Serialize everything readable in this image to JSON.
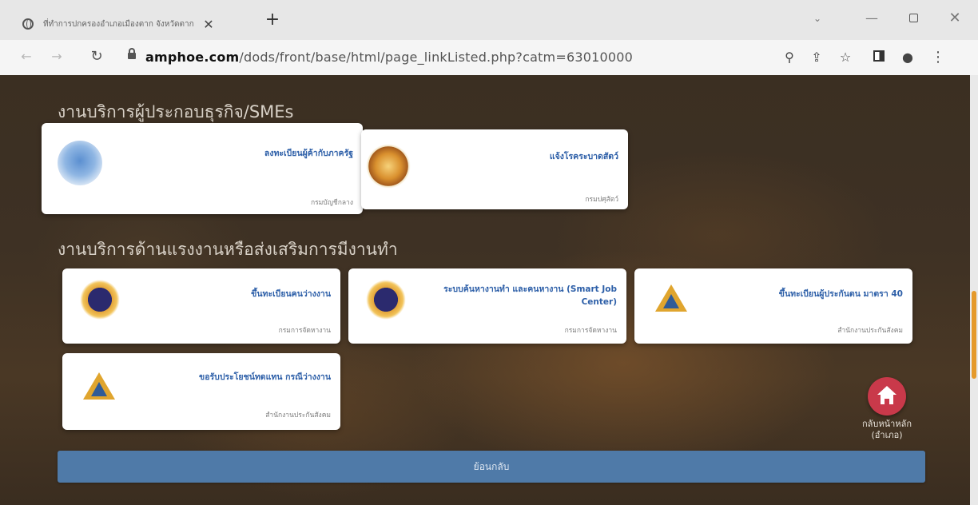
{
  "browser": {
    "tab_title": "ที่ทำการปกครองอำเภอเมืองตาก จังหวัดตาก",
    "tab_close": "✕",
    "new_tab": "+",
    "url_host": "amphoe.com",
    "url_path": "/dods/front/base/html/page_linkListed.php?catm=63010000",
    "icons": [
      "globe-icon",
      "close-icon",
      "plus-icon",
      "back-icon",
      "forward-icon",
      "reload-icon",
      "lock-icon",
      "zoom-icon",
      "share-icon",
      "star-icon",
      "side-panel-icon",
      "profile-icon",
      "menu-icon"
    ]
  },
  "sections": [
    {
      "title": "งานบริการผู้ประกอบธุรกิจ/SMEs",
      "cards": [
        {
          "title": "ลงทะเบียนผู้ค้ากับภาครัฐ",
          "agency": "กรมบัญชีกลาง",
          "logo": "garuda-logo"
        },
        {
          "title": "แจ้งโรคระบาดสัตว์",
          "agency": "กรมปศุสัตว์",
          "logo": "livestock-logo"
        }
      ]
    },
    {
      "title": "งานบริการด้านแรงงานหรือส่งเสริมการมีงานทำ",
      "cards": [
        {
          "title": "ขึ้นทะเบียนคนว่างงาน",
          "agency": "กรมการจัดหางาน",
          "logo": "employment-dept-logo"
        },
        {
          "title": "ระบบค้นหางานทำ และคนหางาน (Smart Job Center)",
          "agency": "กรมการจัดหางาน",
          "logo": "employment-dept-logo"
        },
        {
          "title": "ขึ้นทะเบียนผู้ประกันตน มาตรา 40",
          "agency": "สำนักงานประกันสังคม",
          "logo": "social-security-logo"
        },
        {
          "title": "ขอรับประโยชน์ทดแทน กรณีว่างงาน",
          "agency": "สำนักงานประกันสังคม",
          "logo": "social-security-logo"
        }
      ]
    }
  ],
  "home_button": {
    "label": "กลับหน้าหลัก (อำเภอ)"
  },
  "back_button": {
    "label": "ย้อนกลับ"
  },
  "colors": {
    "card_title": "#2d5fa8",
    "home_button": "#c9394a",
    "back_bar": "#4f7aa8",
    "scroll_thumb": "#e59a2c"
  }
}
